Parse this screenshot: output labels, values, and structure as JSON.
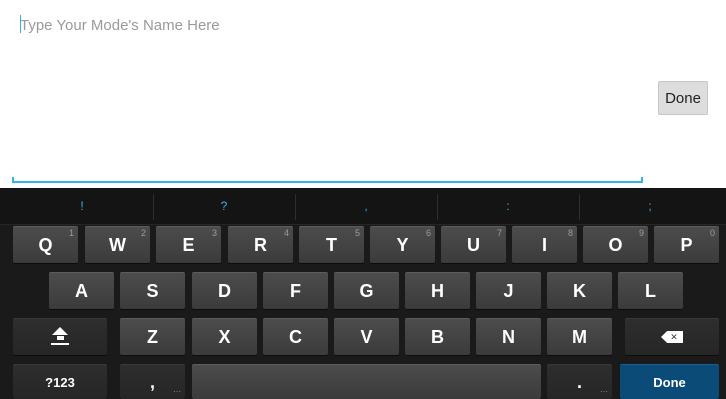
{
  "input": {
    "placeholder": "Type Your Mode's Name Here"
  },
  "done_button": {
    "label": "Done"
  },
  "keyboard": {
    "suggestions": [
      "!",
      "?",
      ",",
      ":",
      ";"
    ],
    "row1": [
      {
        "label": "Q",
        "hint": "1"
      },
      {
        "label": "W",
        "hint": "2"
      },
      {
        "label": "E",
        "hint": "3"
      },
      {
        "label": "R",
        "hint": "4"
      },
      {
        "label": "T",
        "hint": "5"
      },
      {
        "label": "Y",
        "hint": "6"
      },
      {
        "label": "U",
        "hint": "7"
      },
      {
        "label": "I",
        "hint": "8"
      },
      {
        "label": "O",
        "hint": "9"
      },
      {
        "label": "P",
        "hint": "0"
      }
    ],
    "row2": [
      "A",
      "S",
      "D",
      "F",
      "G",
      "H",
      "J",
      "K",
      "L"
    ],
    "row3": [
      "Z",
      "X",
      "C",
      "V",
      "B",
      "N",
      "M"
    ],
    "symbols_label": "?123",
    "comma_label": ",",
    "period_label": ".",
    "done_label": "Done",
    "accent_color": "#33b5e5",
    "done_key_color": "#0a4b78"
  }
}
